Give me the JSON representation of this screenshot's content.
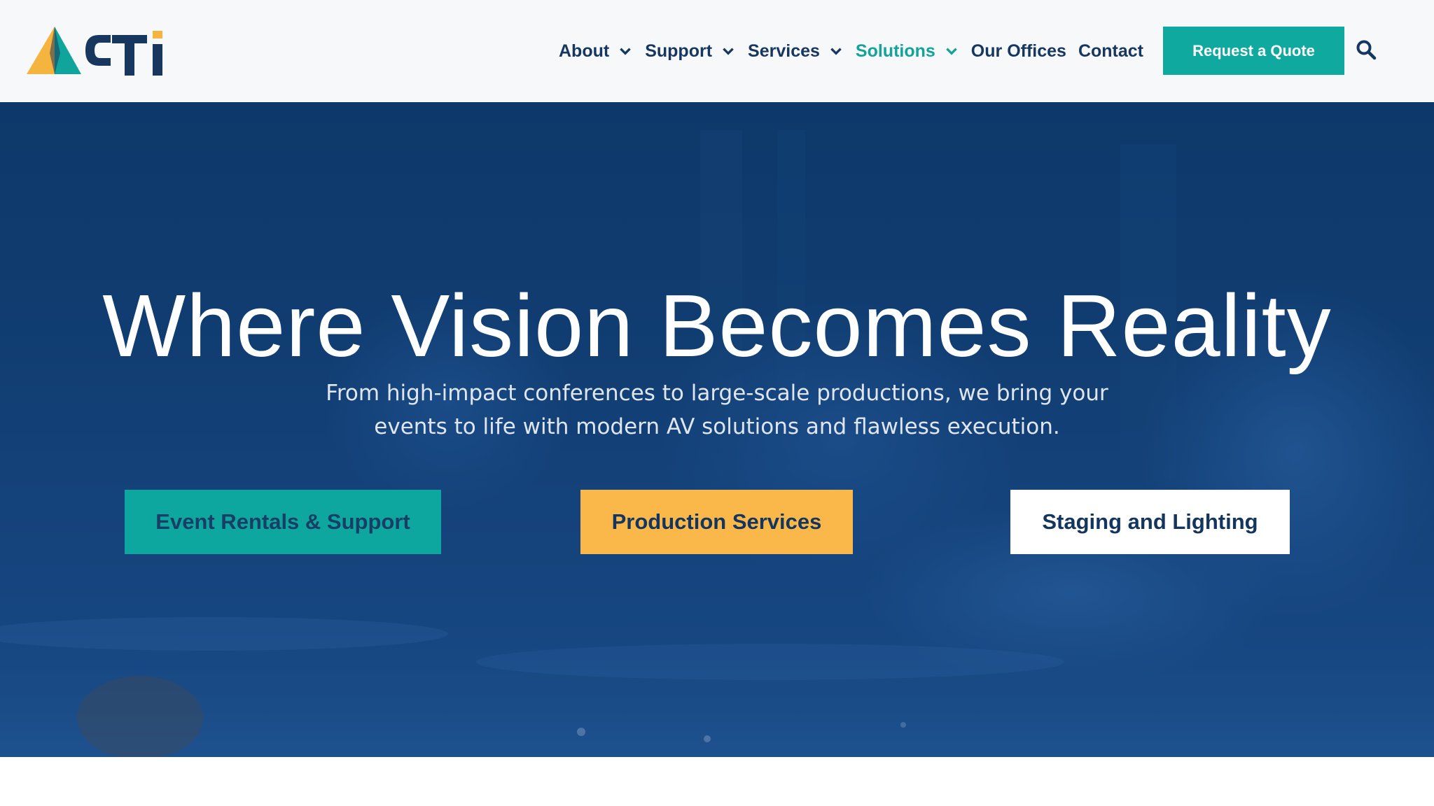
{
  "brand": {
    "logo_text": "CTi",
    "colors": {
      "navy": "#17375e",
      "teal": "#10a9a0",
      "gold": "#fab84a",
      "header_bg": "#f6f8f9",
      "hero_blue": "#123f74"
    }
  },
  "nav": {
    "items": [
      {
        "label": "About",
        "has_dropdown": true,
        "active": false
      },
      {
        "label": "Support",
        "has_dropdown": true,
        "active": false
      },
      {
        "label": "Services",
        "has_dropdown": true,
        "active": false
      },
      {
        "label": "Solutions",
        "has_dropdown": true,
        "active": true
      },
      {
        "label": "Our Offices",
        "has_dropdown": false,
        "active": false
      },
      {
        "label": "Contact",
        "has_dropdown": false,
        "active": false
      }
    ],
    "quote_button": "Request a Quote",
    "search_icon": "search-icon"
  },
  "hero": {
    "title": "Where Vision Becomes Reality",
    "subtitle": "From high-impact conferences to large-scale productions, we bring your events to life with modern AV solutions and flawless execution.",
    "buttons": [
      {
        "label": "Event Rentals & Support"
      },
      {
        "label": "Production Services"
      },
      {
        "label": "Staging and Lighting"
      }
    ]
  }
}
